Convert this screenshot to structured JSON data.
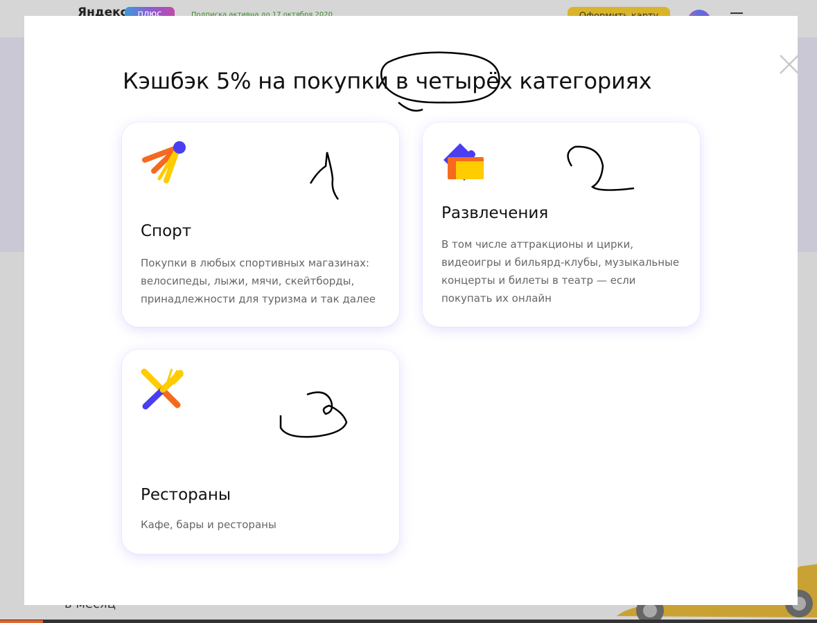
{
  "background_page": {
    "logo": "Яндекс",
    "logo_badge": "плюс",
    "promo_text": "Подписка активна до 17 октября 2020",
    "cta_label": "Оформить карту",
    "bottom_text": "в месяц"
  },
  "modal": {
    "title": "Кэшбэк 5% на покупки в четырёх категориях",
    "close_icon": "close-icon",
    "categories": [
      {
        "icon": "badminton-shuttlecock-icon",
        "title": "Спорт",
        "description": "Покупки в любых спортивных магазинах: велосипеды, лыжи, мячи, скейтборды, принадлежности для туризма и так далее"
      },
      {
        "icon": "tickets-icon",
        "title": "Развлечения",
        "description": "В том числе аттракционы и цирки, видеоигры и бильярд-клубы, музыкальные концерты и билеты в театр — если покупать их онлайн"
      },
      {
        "icon": "fork-knife-icon",
        "title": "Рестораны",
        "description": "Кафе, бары и рестораны"
      }
    ]
  },
  "colors": {
    "accent_orange": "#f56a1f",
    "accent_yellow": "#ffcc00",
    "accent_purple": "#4a3ef0",
    "card_shadow": "#786eff"
  }
}
